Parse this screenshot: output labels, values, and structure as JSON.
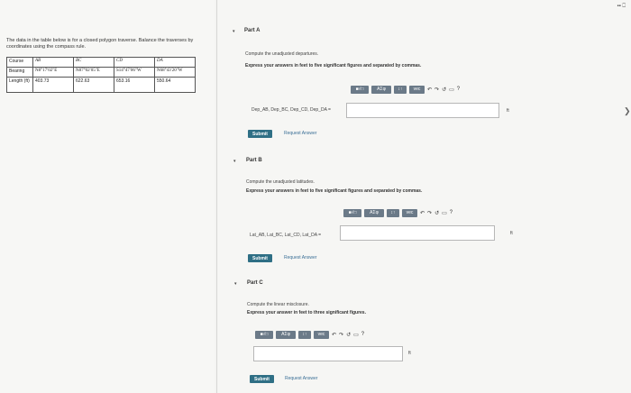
{
  "top_right": "▪▪ ⎕",
  "problem": {
    "text": "The data in the table below is for a closed polygon traverse. Balance the traverses by coordinates using the compass rule.",
    "table": {
      "rows": [
        [
          "Course",
          "AB",
          "BC",
          "CD",
          "DA"
        ],
        [
          "Bearing",
          "N8°17′02″E",
          "N87°02′05″E",
          "S14°47′06″W",
          "N68°43′20″W"
        ],
        [
          "Length (ft)",
          "403.73",
          "622.63",
          "653.16",
          "550.64"
        ]
      ]
    }
  },
  "toolbar": {
    "b1": "■√□",
    "b2": "AΣφ",
    "b3": "↕↑",
    "b4": "vec"
  },
  "parts": [
    {
      "title": "Part A",
      "prompt": "Compute the unadjusted departures.",
      "instruction": "Express your answers in feet to five significant figures and separated by commas.",
      "label": "Dep_AB, Dep_BC, Dep_CD, Dep_DA =",
      "unit": "ft",
      "submit": "Submit",
      "request": "Request Answer",
      "help": "?"
    },
    {
      "title": "Part B",
      "prompt": "Compute the unadjusted latitudes.",
      "instruction": "Express your answers in feet to five significant figures and separated by commas.",
      "label": "Lat_AB, Lat_BC, Lat_CD, Lat_DA =",
      "unit": "ft",
      "submit": "Submit",
      "request": "Request Answer",
      "help": "?"
    },
    {
      "title": "Part C",
      "prompt": "Compute the linear misclosure.",
      "instruction": "Express your answer in feet to three significant figures.",
      "label": "",
      "unit": "ft",
      "submit": "Submit",
      "request": "Request Answer",
      "help": "?"
    }
  ],
  "scroll_glyph": "❯"
}
